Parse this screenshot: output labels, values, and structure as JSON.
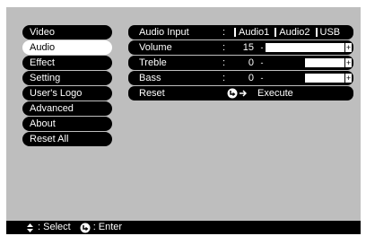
{
  "menu": {
    "items": [
      {
        "label": "Video",
        "selected": false
      },
      {
        "label": "Audio",
        "selected": true
      },
      {
        "label": "Effect",
        "selected": false
      },
      {
        "label": "Setting",
        "selected": false
      },
      {
        "label": "User's Logo",
        "selected": false
      },
      {
        "label": "Advanced",
        "selected": false
      },
      {
        "label": "About",
        "selected": false
      },
      {
        "label": "Reset All",
        "selected": false
      }
    ]
  },
  "settings": {
    "audio_input": {
      "label": "Audio Input",
      "colon": ":",
      "options": [
        "Audio1",
        "Audio2",
        "USB"
      ]
    },
    "volume": {
      "label": "Volume",
      "colon": ":",
      "value": "15",
      "fraction": 0.0
    },
    "treble": {
      "label": "Treble",
      "colon": ":",
      "value": "0",
      "fraction": 0.5
    },
    "bass": {
      "label": "Bass",
      "colon": ":",
      "value": "0",
      "fraction": 0.5
    },
    "reset": {
      "label": "Reset",
      "action": "Execute"
    },
    "slider_minus": "-",
    "slider_plus": "+"
  },
  "footer": {
    "select_text": ": Select",
    "enter_text": ": Enter"
  },
  "colors": {
    "background": "#bebebe",
    "selected_bg": "#ffffff",
    "item_bg": "#000000"
  },
  "icons": {
    "select": "up-down-arrows-icon",
    "enter": "enter-button-icon"
  }
}
